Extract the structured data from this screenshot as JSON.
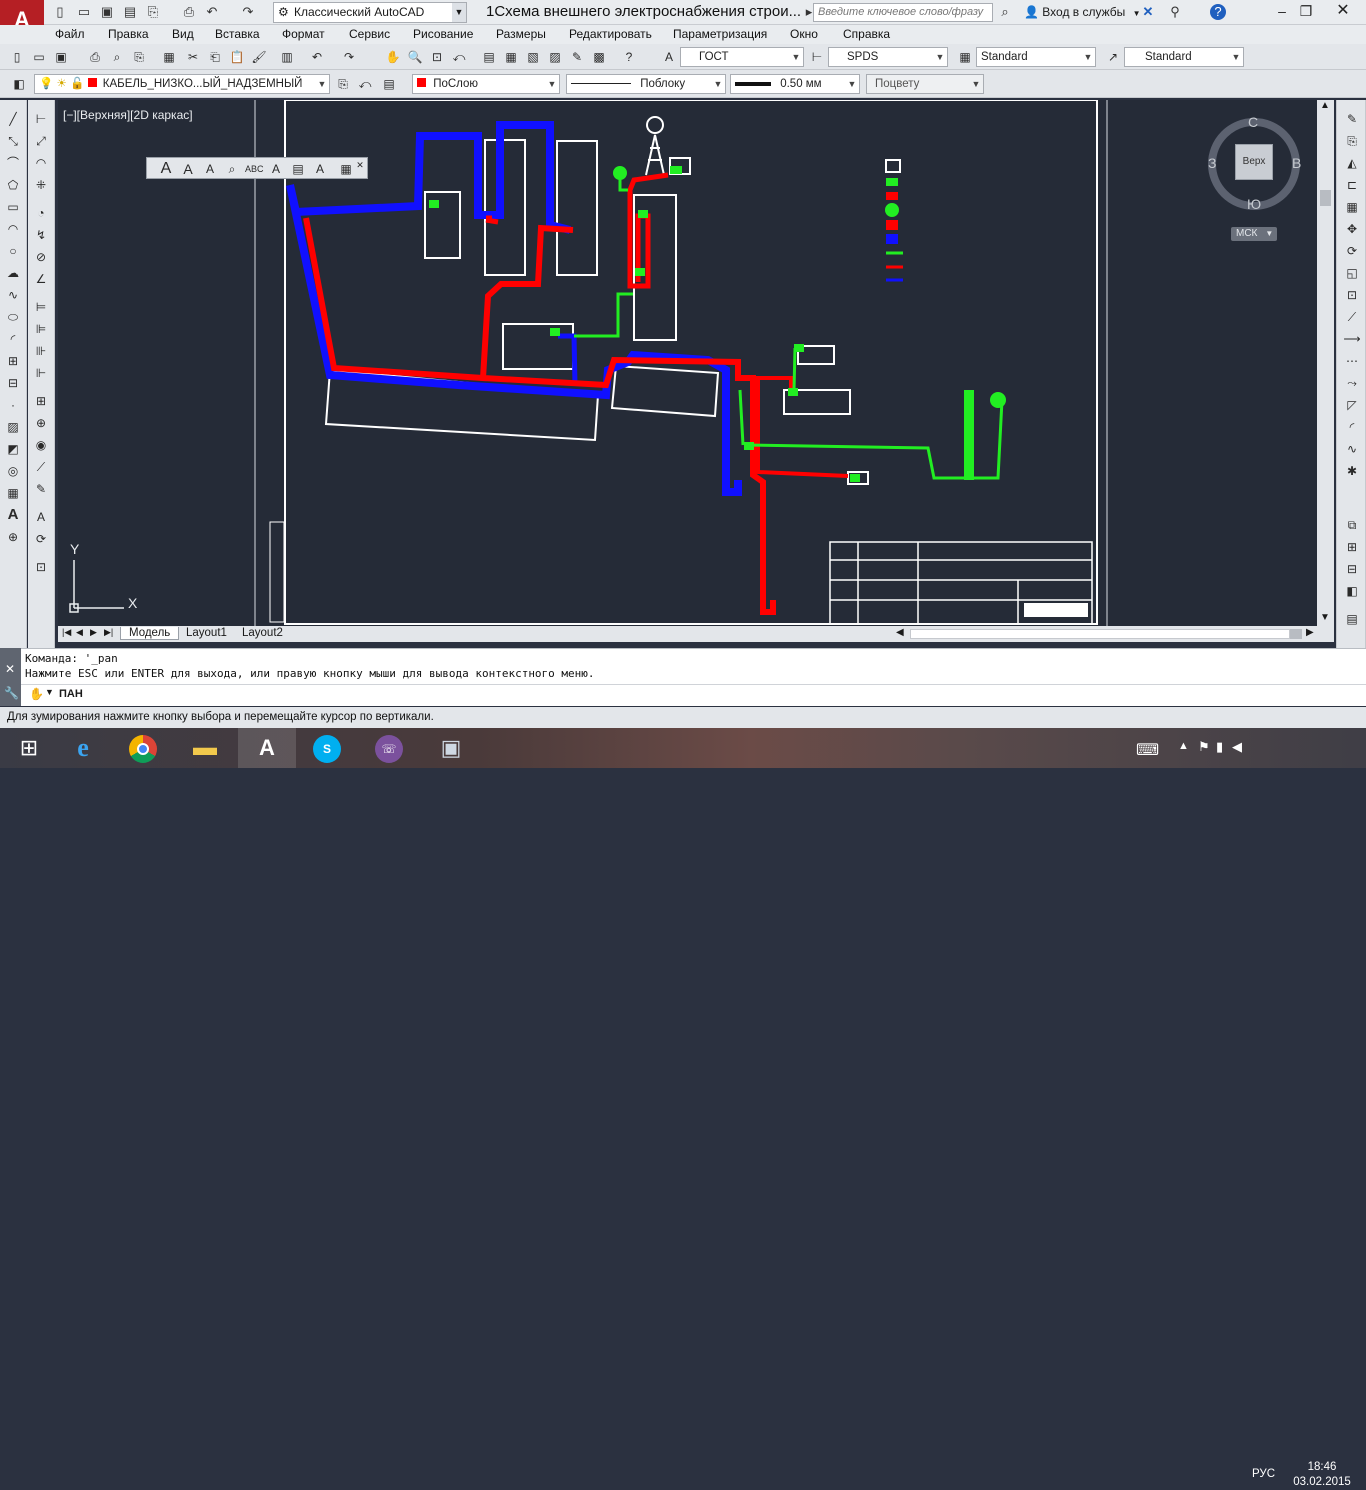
{
  "titlebar": {
    "workspace": "Классический AutoCAD",
    "doc_title": "1Схема внешнего электроснабжения строи...",
    "search_placeholder": "Введите ключевое слово/фразу",
    "signin": "Вход в службы",
    "help": "?"
  },
  "menu": [
    "Файл",
    "Правка",
    "Вид",
    "Вставка",
    "Формат",
    "Сервис",
    "Рисование",
    "Размеры",
    "Редактировать",
    "Параметризация",
    "Окно",
    "Справка"
  ],
  "styles_toolbar": {
    "text_style": "ГОСТ",
    "dim_style": "SPDS",
    "table_style": "Standard",
    "mleader_style": "Standard"
  },
  "layers_toolbar": {
    "layer": "КАБЕЛЬ_НИЗКО...ЫЙ_НАДЗЕМНЫЙ",
    "color": "ПоСлою",
    "linetype": "Поблоку",
    "lineweight": "0.50 мм",
    "plotstyle": "Поцвету"
  },
  "canvas": {
    "view_label": "[−][Верхняя][2D каркас]",
    "viewcube_face": "Верх",
    "compass_n": "С",
    "compass_s": "Ю",
    "compass_w": "З",
    "compass_e": "В",
    "ucs": "МСК",
    "ucs_x": "X",
    "ucs_y": "Y"
  },
  "tabs": [
    "Модель",
    "Layout1",
    "Layout2"
  ],
  "command": {
    "history_1": "Команда: '_pan",
    "history_2": "Нажмите ESC или ENTER для выхода, или правую кнопку мыши для вывода контекстного меню.",
    "prompt": "ПАН"
  },
  "status_text": "Для зумирования нажмите кнопку выбора и перемещайте курсор по вертикали.",
  "taskbar": {
    "lang": "РУС",
    "time": "18:46",
    "date": "03.02.2015"
  },
  "colors": {
    "cable_red": "#ff0000",
    "cable_blue": "#1010ff",
    "cable_green": "#22ee22",
    "canvas_bg": "#252b37",
    "autocad_red": "#b51f24"
  }
}
